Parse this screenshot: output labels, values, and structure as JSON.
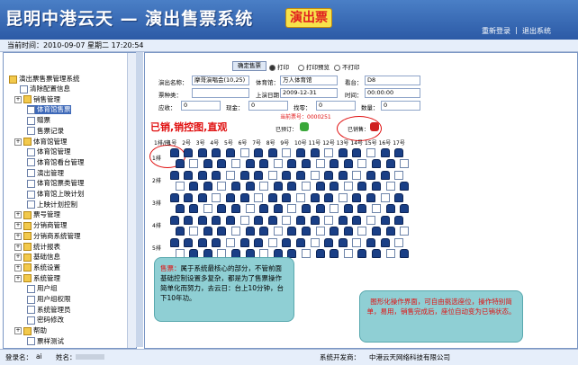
{
  "header": {
    "title": "昆明中港云天 — 演出售票系统",
    "logo_text": "演出票",
    "relogin_label": "重新登录",
    "logout_label": "退出系统"
  },
  "infobar": {
    "time_label": "当前时间：2010-09-07 星期二 17:20:54"
  },
  "sidebar": {
    "root": "演出票售票管理系统",
    "items": [
      {
        "label": "清除配置信息",
        "level": 1,
        "kind": "doc"
      },
      {
        "label": "销售管理",
        "level": 0,
        "kind": "folder"
      },
      {
        "label": "体育馆售票",
        "level": 2,
        "kind": "doc",
        "selected": true
      },
      {
        "label": "赠票",
        "level": 2,
        "kind": "doc"
      },
      {
        "label": "售票记录",
        "level": 2,
        "kind": "doc"
      },
      {
        "label": "体育馆管理",
        "level": 0,
        "kind": "folder"
      },
      {
        "label": "体育馆管理",
        "level": 2,
        "kind": "doc"
      },
      {
        "label": "体育馆看台管理",
        "level": 2,
        "kind": "doc"
      },
      {
        "label": "演出管理",
        "level": 2,
        "kind": "doc"
      },
      {
        "label": "体育馆票类管理",
        "level": 2,
        "kind": "doc"
      },
      {
        "label": "体育馆上映计划",
        "level": 2,
        "kind": "doc"
      },
      {
        "label": "上映计划控制",
        "level": 2,
        "kind": "doc"
      },
      {
        "label": "票号管理",
        "level": 0,
        "kind": "folder"
      },
      {
        "label": "分销商管理",
        "level": 0,
        "kind": "folder"
      },
      {
        "label": "分销商系统管理",
        "level": 0,
        "kind": "folder"
      },
      {
        "label": "统计报表",
        "level": 0,
        "kind": "folder"
      },
      {
        "label": "基础信息",
        "level": 0,
        "kind": "folder"
      },
      {
        "label": "系统设置",
        "level": 0,
        "kind": "folder"
      },
      {
        "label": "系统管理",
        "level": 0,
        "kind": "folder"
      },
      {
        "label": "用户组",
        "level": 2,
        "kind": "doc"
      },
      {
        "label": "用户组权限",
        "level": 2,
        "kind": "doc"
      },
      {
        "label": "系统管理员",
        "level": 2,
        "kind": "doc"
      },
      {
        "label": "密码修改",
        "level": 2,
        "kind": "doc"
      },
      {
        "label": "帮助",
        "level": 0,
        "kind": "folder"
      },
      {
        "label": "票样测试",
        "level": 2,
        "kind": "doc"
      }
    ]
  },
  "main": {
    "query_button": "确定售票",
    "radios": [
      {
        "label": "打印",
        "checked": true
      },
      {
        "label": "打印预览",
        "checked": false
      },
      {
        "label": "不打印",
        "checked": false
      }
    ],
    "fields": {
      "show_name_label": "演出名称：",
      "show_name_value": "摩哥演唱会(10,25)",
      "venue_label": "体育馆：",
      "venue_value": "万人体育馆",
      "stand_label": "看台：",
      "stand_value": "D8",
      "ticket_type_label": "票种类：",
      "date_label": "上演日期：",
      "date_value": "2009-12-31",
      "time_label": "时间：",
      "time_value": "00:00:00",
      "receivable_label": "应收：",
      "receivable_value": "0",
      "cash_label": "现金：",
      "cash_value": "0",
      "change_label": "找零：",
      "change_value": "0",
      "count_label": "数量：",
      "count_value": "0"
    },
    "current_ticket": "当前票号：0000251",
    "legend_available": "已预订：",
    "legend_sold": "已销售：",
    "sold_note": "已销,销控图,直观",
    "column_labels": [
      "1排/座",
      "1号",
      "2号",
      "3号",
      "4号",
      "5号",
      "6号",
      "7号",
      "8号",
      "9号",
      "10号",
      "11号",
      "12号",
      "13号",
      "14号",
      "15号",
      "16号",
      "17号"
    ],
    "row_labels": [
      "1排",
      "2排",
      "3排",
      "4排",
      "5排"
    ],
    "callout_left_title": "售票：",
    "callout_left_text": "属于系统最核心的部分，不管前面基础控制设置多复杂，都是为了售票操作简单化而努力，去云日：台上10分钟，台下10年功。",
    "callout_right_text": "图形化操作界面，可自由挑选座位，操作特别简单，易用，销售完成后，座位自动变为已销状态。"
  },
  "statusbar": {
    "operator_label": "登录名：",
    "operator_value": "ai",
    "name_label": "姓名：",
    "developer_label": "系统开发商：",
    "developer_value": "中港云天网络科技有限公司"
  },
  "colors": {
    "header_bg": "#3566b2",
    "sold_seat": "#1a3f86",
    "accent_red": "#e01010",
    "callout_bg": "#8fcfd4"
  }
}
